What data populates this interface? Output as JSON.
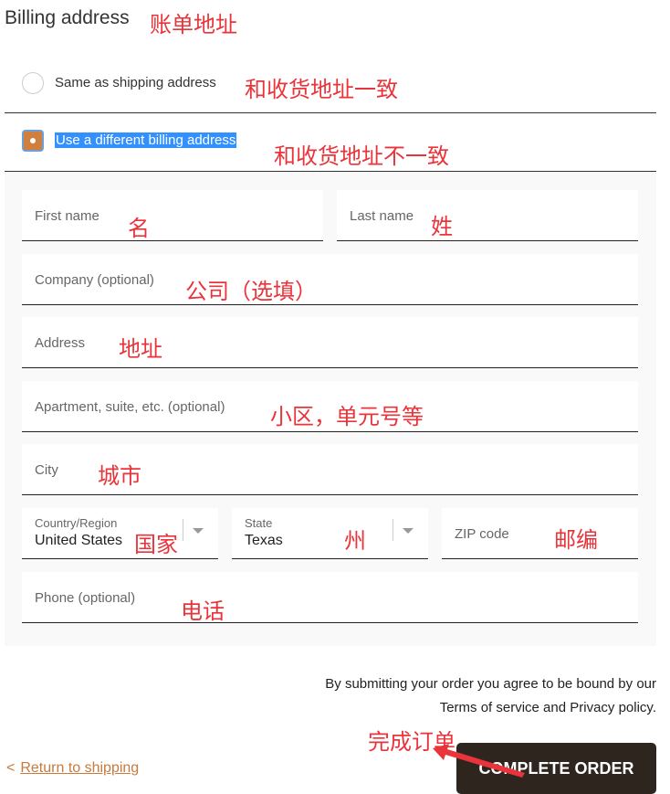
{
  "billing": {
    "title": "Billing address",
    "options": [
      {
        "label": "Same as shipping address",
        "selected": false
      },
      {
        "label": "Use a different billing address",
        "selected": true
      }
    ]
  },
  "form": {
    "first_name": "First name",
    "last_name": "Last name",
    "company": "Company (optional)",
    "address": "Address",
    "apartment": "Apartment, suite, etc. (optional)",
    "city": "City",
    "country": {
      "label": "Country/Region",
      "value": "United States"
    },
    "state": {
      "label": "State",
      "value": "Texas"
    },
    "zip": "ZIP code",
    "phone": "Phone (optional)"
  },
  "footer": {
    "terms_line1": "By submitting your order you agree to be bound by our",
    "terms_line2": "Terms of service and Privacy policy.",
    "return_label": "Return to shipping",
    "return_chevron": "<",
    "complete_label": "COMPLETE ORDER"
  },
  "annotations": {
    "billing": "账单地址",
    "same": "和收货地址一致",
    "different": "和收货地址不一致",
    "first": "名",
    "last": "姓",
    "company": "公司（选填）",
    "address": "地址",
    "apartment": "小区，单元号等",
    "city": "城市",
    "country": "国家",
    "state": "州",
    "zip": "邮编",
    "phone": "电话",
    "complete": "完成订单"
  },
  "colors": {
    "accent": "#d17f3e",
    "button_bg": "#2f251f",
    "link": "#c77a3c",
    "annotation": "#e8343a"
  }
}
